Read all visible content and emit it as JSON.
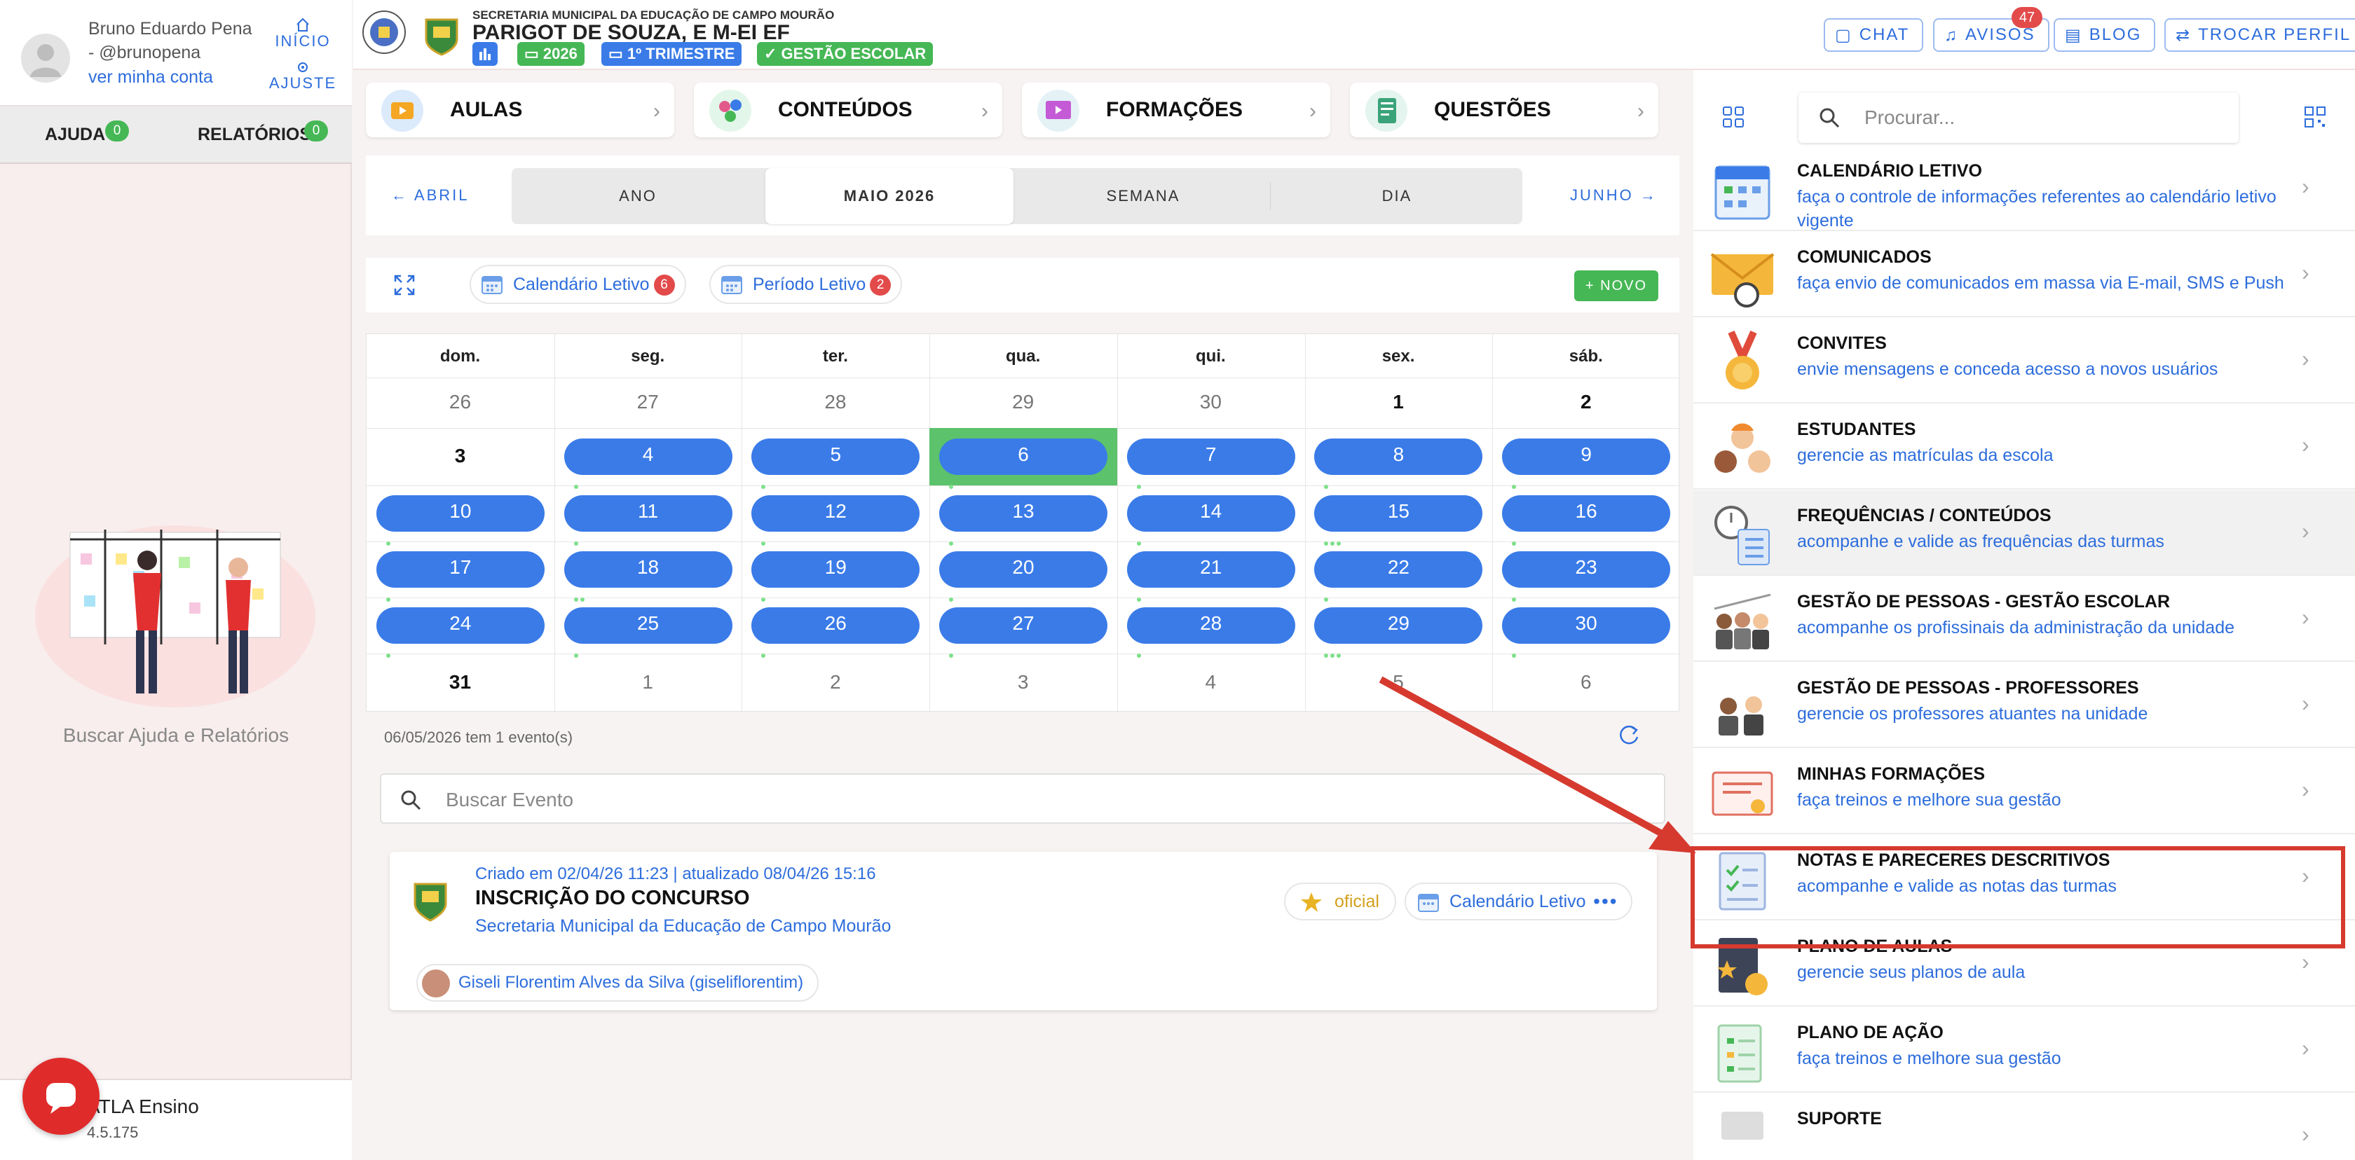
{
  "user": {
    "name": "Bruno Eduardo Pena - @brunopena",
    "account_link": "ver minha conta"
  },
  "sidebar": {
    "shortcuts": [
      {
        "label": "INÍCIO",
        "icon": "home-icon"
      },
      {
        "label": "AJUSTE",
        "icon": "gear-icon"
      }
    ],
    "tabs": [
      {
        "label": "AJUDA",
        "count": "0"
      },
      {
        "label": "RELATÓRIOS",
        "count": "0"
      }
    ],
    "help_caption": "Buscar Ajuda e Relatórios",
    "footer_title": "ATLA Ensino",
    "footer_version": "4.5.175"
  },
  "header": {
    "secretaria": "SECRETARIA MUNICIPAL DA EDUCAÇÃO DE CAMPO MOURÃO",
    "school": "PARIGOT DE SOUZA, E M-EI EF",
    "chips": [
      {
        "label": "2026",
        "color": "#46b755"
      },
      {
        "label": "1º TRIMESTRE",
        "color": "#3a7be8"
      },
      {
        "label": "GESTÃO ESCOLAR",
        "color": "#46b755"
      }
    ],
    "buttons": [
      {
        "label": "CHAT",
        "icon": "chat-icon"
      },
      {
        "label": "AVISOS",
        "icon": "bell-icon",
        "badge": "47"
      },
      {
        "label": "BLOG",
        "icon": "blog-icon"
      },
      {
        "label": "TROCAR PERFIL",
        "icon": "swap-icon"
      }
    ]
  },
  "modules": [
    {
      "label": "AULAS",
      "icon": "aulas-icon"
    },
    {
      "label": "CONTEÚDOS",
      "icon": "conteudos-icon"
    },
    {
      "label": "FORMAÇÕES",
      "icon": "formacoes-icon"
    },
    {
      "label": "QUESTÕES",
      "icon": "questoes-icon"
    }
  ],
  "calendar": {
    "prev_label": "ABRIL",
    "next_label": "JUNHO",
    "views": [
      "ANO",
      "MAIO 2026",
      "SEMANA",
      "DIA"
    ],
    "active_view": "MAIO 2026",
    "filters": [
      {
        "label": "Calendário Letivo",
        "count": "6"
      },
      {
        "label": "Período Letivo",
        "count": "2"
      }
    ],
    "new_label": "NOVO",
    "weekdays": [
      "dom.",
      "seg.",
      "ter.",
      "qua.",
      "qui.",
      "sex.",
      "sáb."
    ],
    "weeks": [
      [
        "26",
        "27",
        "28",
        "29",
        "30",
        "1",
        "2"
      ],
      [
        "3",
        "4",
        "5",
        "6",
        "7",
        "8",
        "9"
      ],
      [
        "10",
        "11",
        "12",
        "13",
        "14",
        "15",
        "16"
      ],
      [
        "17",
        "18",
        "19",
        "20",
        "21",
        "22",
        "23"
      ],
      [
        "24",
        "25",
        "26",
        "27",
        "28",
        "29",
        "30"
      ],
      [
        "31",
        "1",
        "2",
        "3",
        "4",
        "5",
        "6"
      ]
    ],
    "selected_day": "6",
    "summary": "06/05/2026 tem 1 evento(s)",
    "search_placeholder": "Buscar Evento"
  },
  "event": {
    "meta": "Criado em 02/04/26 11:23 | atualizado 08/04/26 15:16",
    "title": "INSCRIÇÃO DO CONCURSO",
    "org": "Secretaria Municipal da Educação de Campo Mourão",
    "official_label": "oficial",
    "calendar_label": "Calendário Letivo",
    "author": "Giseli Florentim Alves da Silva (giseliflorentim)"
  },
  "right_panel": {
    "search_placeholder": "Procurar...",
    "items": [
      {
        "title": "CALENDÁRIO LETIVO",
        "desc": "faça o controle de informações referentes ao calendário letivo vigente",
        "icon": "calendar-icon"
      },
      {
        "title": "COMUNICADOS",
        "desc": "faça envio de comunicados em massa via E-mail, SMS e Push",
        "icon": "envelope-icon"
      },
      {
        "title": "CONVITES",
        "desc": "envie mensagens e conceda acesso a novos usuários",
        "icon": "medal-icon"
      },
      {
        "title": "ESTUDANTES",
        "desc": "gerencie as matrículas da escola",
        "icon": "students-icon"
      },
      {
        "title": "FREQUÊNCIAS / CONTEÚDOS",
        "desc": "acompanhe e valide as frequências das turmas",
        "icon": "clock-checklist-icon"
      },
      {
        "title": "GESTÃO DE PESSOAS - GESTÃO ESCOLAR",
        "desc": "acompanhe os profissinais da administração da unidade",
        "icon": "staff-icon"
      },
      {
        "title": "GESTÃO DE PESSOAS - PROFESSORES",
        "desc": "gerencie os professores atuantes na unidade",
        "icon": "teachers-icon"
      },
      {
        "title": "MINHAS FORMAÇÕES",
        "desc": "faça treinos e melhore sua gestão",
        "icon": "certificate-icon"
      },
      {
        "title": "NOTAS E PARECERES DESCRITIVOS",
        "desc": "acompanhe e valide as notas das turmas",
        "icon": "grades-icon"
      },
      {
        "title": "PLANO DE AULAS",
        "desc": "gerencie seus planos de aula",
        "icon": "lesson-plan-icon"
      },
      {
        "title": "PLANO DE AÇÃO",
        "desc": "faça treinos e melhore sua gestão",
        "icon": "action-plan-icon"
      },
      {
        "title": "SUPORTE",
        "desc": "",
        "icon": "support-icon"
      }
    ]
  },
  "colors": {
    "accent": "#2d6ddc",
    "pill": "#3a7be8",
    "success": "#46b755",
    "danger": "#e34a4a",
    "annotation": "#d63a2f"
  }
}
